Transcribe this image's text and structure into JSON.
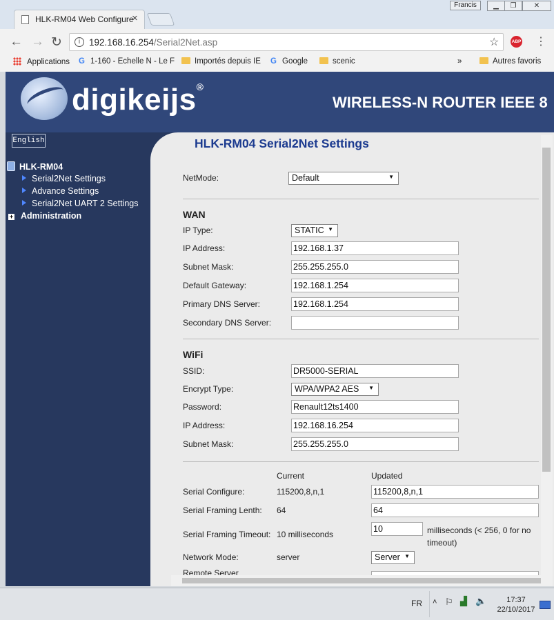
{
  "browser": {
    "tab_title": "HLK-RM04 Web Configure",
    "user_button": "Francis",
    "url_host": "192.168.16.254",
    "url_path": "/Serial2Net.asp",
    "bookmarks": [
      {
        "label": "Applications",
        "icon": "apps-grid-icon"
      },
      {
        "label": "1-160 - Echelle N - Le F",
        "icon": "google-icon"
      },
      {
        "label": "Importés depuis IE",
        "icon": "folder-icon"
      },
      {
        "label": "Google",
        "icon": "google-icon"
      },
      {
        "label": "scenic",
        "icon": "folder-icon"
      }
    ],
    "more_bookmarks": "»",
    "other_bookmarks": "Autres favoris"
  },
  "banner": {
    "logo_text": "digikeijs",
    "logo_reg": "®",
    "tagline": "WIRELESS-N ROUTER IEEE 8"
  },
  "sidebar": {
    "language_button": "English",
    "root": "HLK-RM04",
    "items": [
      "Serial2Net Settings",
      "Advance Settings",
      "Serial2Net UART 2 Settings"
    ],
    "admin": "Administration"
  },
  "main": {
    "title": "HLK-RM04 Serial2Net Settings",
    "netmode": {
      "label": "NetMode:",
      "value": "Default"
    },
    "wan": {
      "heading": "WAN",
      "ip_type_label": "IP Type:",
      "ip_type": "STATIC",
      "ip_label": "IP Address:",
      "ip": "192.168.1.37",
      "mask_label": "Subnet Mask:",
      "mask": "255.255.255.0",
      "gw_label": "Default Gateway:",
      "gw": "192.168.1.254",
      "dns1_label": "Primary DNS Server:",
      "dns1": "192.168.1.254",
      "dns2_label": "Secondary DNS Server:",
      "dns2": ""
    },
    "wifi": {
      "heading": "WiFi",
      "ssid_label": "SSID:",
      "ssid": "DR5000-SERIAL",
      "enc_label": "Encrypt Type:",
      "enc": "WPA/WPA2 AES",
      "pwd_label": "Password:",
      "pwd": "Renault12ts1400",
      "ip_label": "IP Address:",
      "ip": "192.168.16.254",
      "mask_label": "Subnet Mask:",
      "mask": "255.255.255.0"
    },
    "serial": {
      "current_header": "Current",
      "updated_header": "Updated",
      "configure_label": "Serial Configure:",
      "configure_current": "115200,8,n,1",
      "configure_updated": "115200,8,n,1",
      "framing_len_label": "Serial Framing Lenth:",
      "framing_len_current": "64",
      "framing_len_updated": "64",
      "framing_timeout_label": "Serial Framing Timeout:",
      "framing_timeout_current": "10 milliseconds",
      "framing_timeout_updated": "10",
      "framing_timeout_hint": "milliseconds (< 256, 0 for no timeout)",
      "network_mode_label": "Network Mode:",
      "network_mode_current": "server",
      "network_mode_updated": "Server",
      "remote_server_label": "Remote Server"
    }
  },
  "taskbar": {
    "language": "FR",
    "time": "17:37",
    "date": "22/10/2017"
  }
}
